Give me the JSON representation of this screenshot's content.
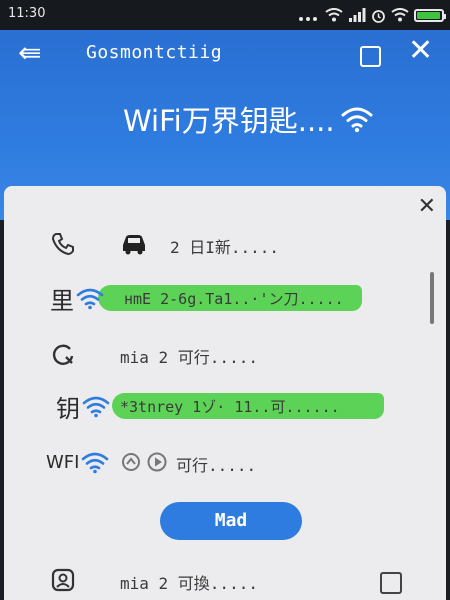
{
  "status_bar": {
    "time": "11:30",
    "battery_level": 0.9
  },
  "app_bar": {
    "title": "Gosmontctiig",
    "headline": "WiFi万界钥匙...."
  },
  "rows": [
    {
      "lead": "",
      "text": "2 日I新....."
    },
    {
      "lead": "里",
      "text": "нmE 2-6g.Ta1..·'ン刀....."
    },
    {
      "lead": "",
      "text": "mia 2 可行....."
    },
    {
      "lead": "钥",
      "text": "*3tnrey 1ゾ· 11..可......"
    },
    {
      "lead": "WFI",
      "text": "可行....."
    },
    {
      "lead": "",
      "text": "mia 2 可換....."
    }
  ],
  "action_button": {
    "label": "Mad"
  },
  "colors": {
    "primary": "#2f7ce0",
    "highlight": "#4fcf4a",
    "card": "#ececee"
  }
}
